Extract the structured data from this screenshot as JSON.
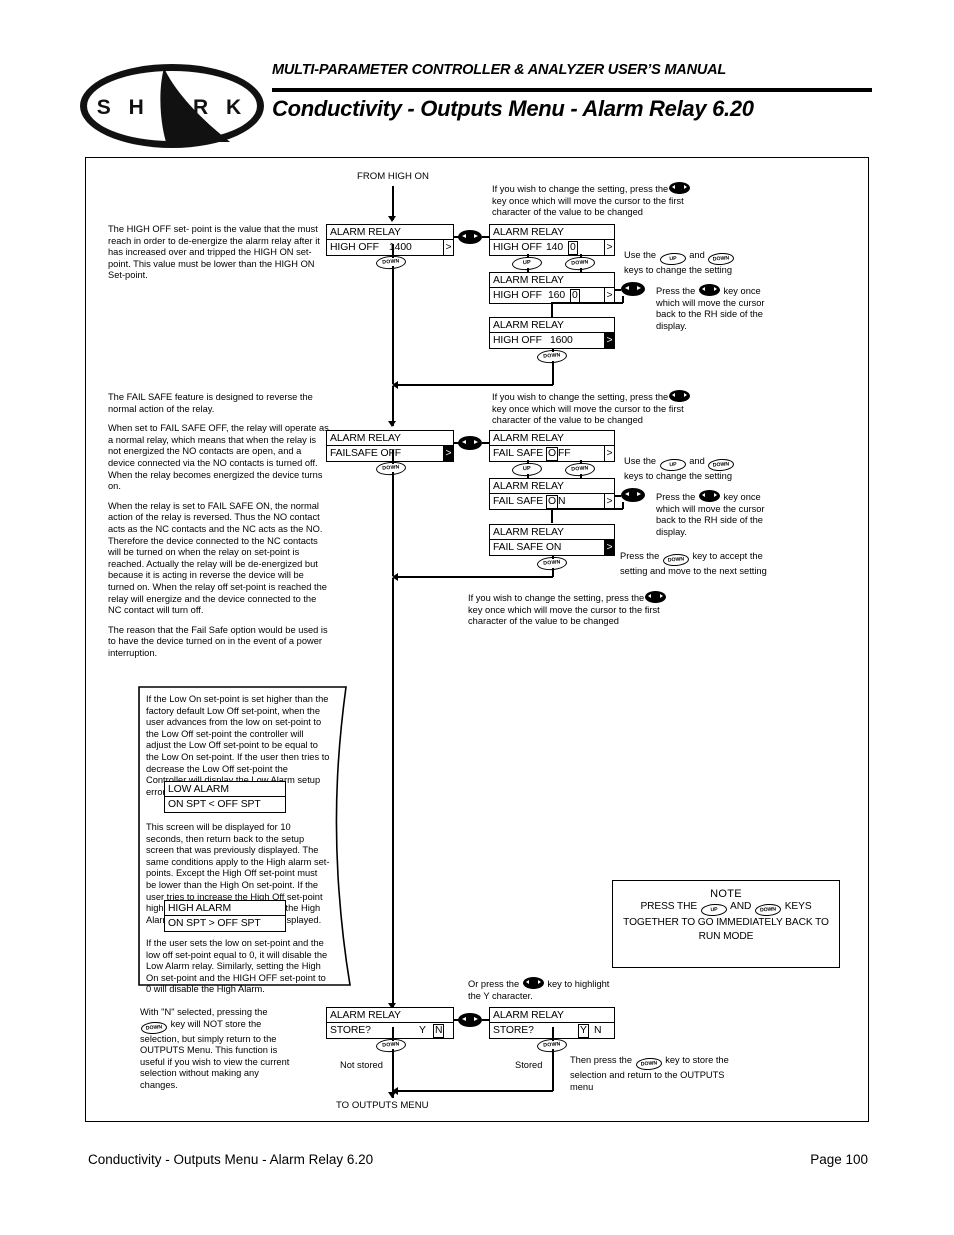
{
  "header": {
    "logo_text": "S H A R K",
    "manual_title": "MULTI-PARAMETER CONTROLLER & ANALYZER USER’S MANUAL",
    "page_title": "Conductivity - Outputs Menu - Alarm Relay 6.20"
  },
  "footer": {
    "left": "Conductivity - Outputs Menu - Alarm Relay 6.20",
    "right": "Page 100"
  },
  "flow": {
    "entry_label": "FROM HIGH ON",
    "exit_label": "TO OUTPUTS MENU",
    "not_stored": "Not stored",
    "stored": "Stored"
  },
  "keys": {
    "up": "UP",
    "down": "DOWN",
    "leftright": "left-right-arrow"
  },
  "sections": {
    "high_off": {
      "description": "The HIGH OFF set- point is the value that the must reach in order to de-energize the alarm relay after it has increased over and tripped the HIGH ON set-point. This value must be lower than the HIGH ON Set-point.",
      "instruction_change": "If you wish to change the setting, press the",
      "instruction_change_2": "key once which will move the cursor to the first",
      "instruction_change_3": "character of the value to be changed",
      "use_keys_1": "Use the",
      "use_keys_and": "and",
      "use_keys_2": "keys to change the setting",
      "press_back_1": "Press the",
      "press_back_2": "key once",
      "press_back_3": "which will move the cursor",
      "press_back_4": "back to the RH side of the",
      "press_back_5": "display.",
      "screens": {
        "main": {
          "line1": "ALARM RELAY",
          "label": "HIGH OFF",
          "value": "1400",
          "caret": ">",
          "caret_inverse": false
        },
        "cursor_first": {
          "line1": "ALARM RELAY",
          "label": "HIGH OFF",
          "value_pre": "140",
          "value_cursor": "0",
          "caret": ">",
          "caret_inverse": false
        },
        "changed": {
          "line1": "ALARM RELAY",
          "label": "HIGH OFF",
          "value_pre": "160",
          "value_cursor": "0",
          "caret": ">",
          "caret_inverse": false
        },
        "accepted": {
          "line1": "ALARM RELAY",
          "label": "HIGH OFF",
          "value": "1600",
          "caret": ">",
          "caret_inverse": true
        }
      }
    },
    "fail_safe": {
      "description_1": "The FAIL SAFE feature is designed to reverse the normal action of the relay.",
      "description_2": "When set to FAIL SAFE OFF, the relay will operate as a normal relay, which means that when the relay is not energized the NO contacts are open, and a device connected via the NO contacts is turned off. When the relay becomes energized the device turns on.",
      "description_3": "When the relay is set to FAIL SAFE ON, the normal action of the relay is reversed. Thus the NO contact acts as the NC contacts and the NC acts as the NO. Therefore the device connected to the NC contacts will be turned on when the relay on set-point is reached. Actually the relay will be de-energized but because it is acting in reverse the device will be turned on. When the relay off set-point is reached the relay will energize and the device connected to the NC contact will turn off.",
      "description_4": "The reason that the Fail Safe option would be used is to have the device turned on in the event of a power interruption.",
      "instruction_change": "If you wish to change the setting, press the",
      "instruction_change_2": "key once which will move the cursor to the first",
      "instruction_change_3": "character of the value to be changed",
      "use_keys_1": "Use the",
      "use_keys_and": "and",
      "use_keys_2": "keys to change the setting",
      "press_back_1": "Press the",
      "press_back_2": "key once",
      "press_back_3": "which will move the cursor",
      "press_back_4": "back to the RH side of the",
      "press_back_5": "display.",
      "accept_1": "Press the",
      "accept_2": "key to accept the",
      "accept_3": "setting and move to the next setting",
      "screens": {
        "main": {
          "line1": "ALARM RELAY",
          "label": "FAILSAFE  OFF",
          "caret": ">",
          "caret_inverse": true
        },
        "cursor_first": {
          "line1": "ALARM RELAY",
          "label": "FAIL SAFE",
          "value_cursor": "O",
          "value_post": "FF",
          "caret": ">",
          "caret_inverse": false
        },
        "changed": {
          "line1": "ALARM RELAY",
          "label": "FAIL SAFE",
          "value_cursor": "O",
          "value_post": "N",
          "caret": ">",
          "caret_inverse": false
        },
        "accepted": {
          "line1": "ALARM RELAY",
          "label": "FAIL SAFE  ON",
          "caret": ">",
          "caret_inverse": true
        }
      }
    },
    "next_setting_instruction": {
      "line1": "If you wish to change the setting, press the",
      "line2": "key once which will move the cursor to the first",
      "line3": "character of the value to be changed"
    },
    "alarm_limits_callout": {
      "para_1": "If the Low On set-point is set higher than the factory default Low Off set-point, when the user advances from the low on set-point to the Low Off set-point the controller will adjust the Low Off set-point to be equal to the Low On set-point. If the user then tries to decrease the Low Off set-point the Controller will display the Low Alarm setup error screen.",
      "low_alarm_screen": {
        "line1": "LOW ALARM",
        "line2": "ON  SPT  <  OFF  SPT"
      },
      "para_2": "This screen will be displayed for 10 seconds, then return back to the setup screen that was previously displayed. The same conditions apply to the High alarm set-points. Except the High Off set-point must be lower than the High On set-point. If the user tries to increase the High Off set-point higher than the High On set-point the High Alarm setup error screen will be displayed.",
      "high_alarm_screen": {
        "line1": "HIGH ALARM",
        "line2": "ON  SPT  >  OFF  SPT"
      },
      "para_3": "If the user sets the low on set-point and the low off set-point equal to 0, it will disable the Low Alarm relay. Similarly, setting the High On set-point and the HIGH OFF set-point to 0 will disable the High Alarm."
    },
    "store": {
      "description_n": "With \"N\" selected, pressing the",
      "description_n_2": "key will NOT store the selection, but simply return to the OUTPUTS Menu. This function is useful if you wish to view the current selection without making any changes.",
      "highlight_1": "Or press the",
      "highlight_2": "key to highlight",
      "highlight_3": "the Y character.",
      "then_press_1": "Then press the",
      "then_press_2": "key to store the",
      "then_press_3": "selection and return to the OUTPUTS",
      "then_press_4": "menu",
      "screen_n": {
        "line1": "ALARM RELAY",
        "label": "STORE?",
        "y": "Y",
        "n": "N",
        "selected": "N"
      },
      "screen_y": {
        "line1": "ALARM RELAY",
        "label": "STORE?",
        "y": "Y",
        "n": "N",
        "selected": "Y"
      }
    }
  },
  "note": {
    "title": "NOTE",
    "line1_a": "PRESS THE",
    "line1_and": "AND",
    "line1_b": "KEYS",
    "line2": "TOGETHER TO GO IMMEDIATELY BACK TO",
    "line3": "RUN MODE"
  }
}
